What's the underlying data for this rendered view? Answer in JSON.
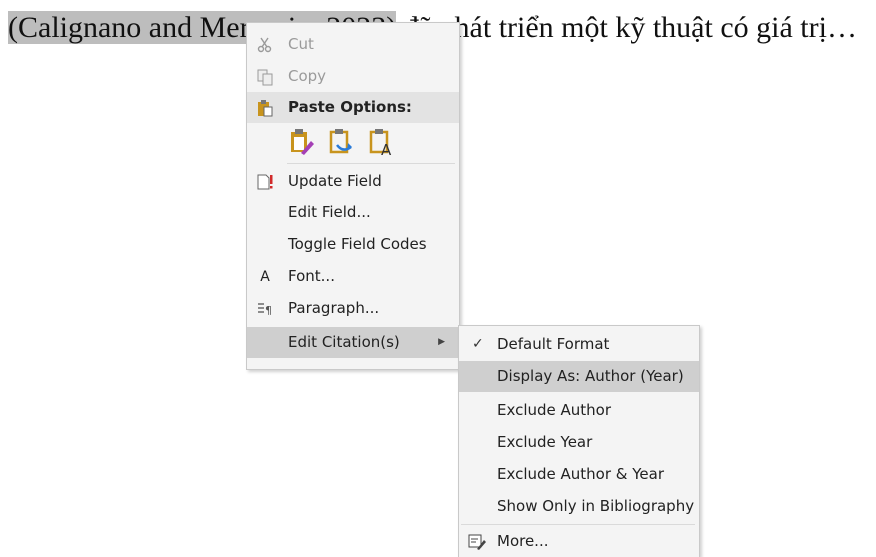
{
  "document": {
    "selected_text": "(Calignano and Mercurio, 2023)",
    "trailing_text": " đã phát triển một kỹ thuật có giá trị…"
  },
  "context_menu": {
    "cut": "Cut",
    "copy": "Copy",
    "paste_options": "Paste Options:",
    "update_field": "Update Field",
    "edit_field": "Edit Field...",
    "toggle_field_codes": "Toggle Field Codes",
    "font": "Font...",
    "paragraph": "Paragraph...",
    "edit_citations": "Edit Citation(s)"
  },
  "submenu": {
    "default_format": "Default Format",
    "display_as_author_year": "Display As: Author (Year)",
    "exclude_author": "Exclude Author",
    "exclude_year": "Exclude Year",
    "exclude_author_year": "Exclude Author & Year",
    "show_only_bibliography": "Show Only in Bibliography",
    "more": "More...",
    "checked_item": "Default Format",
    "highlighted_item": "Display As: Author (Year)"
  },
  "icons": {
    "cut": "scissors-icon",
    "copy": "copy-icon",
    "paste": "clipboard-icon",
    "update_field": "update-field-icon",
    "font": "font-icon",
    "paragraph": "paragraph-icon",
    "more": "citation-edit-icon",
    "submenu_arrow": "chevron-right-icon",
    "check": "checkmark-icon"
  },
  "colors": {
    "menu_background": "#f4f4f4",
    "highlight": "#cfcfcf",
    "selection": "#bdbdbd"
  }
}
